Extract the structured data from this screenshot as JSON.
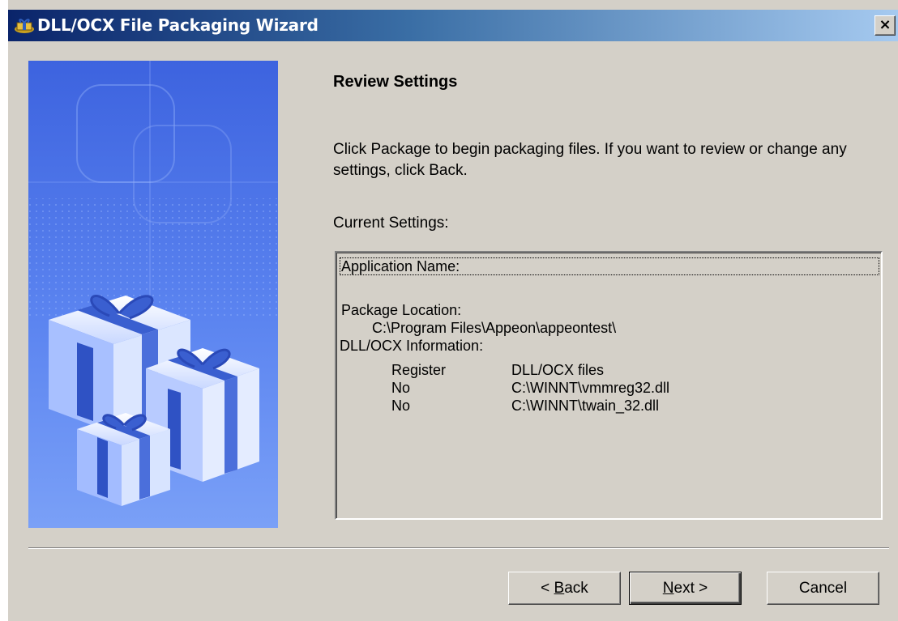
{
  "window": {
    "title": "DLL/OCX File Packaging Wizard",
    "close_label": "×"
  },
  "page": {
    "heading": "Review Settings",
    "intro": "Click Package to begin packaging files. If you want to review or change any settings, click Back.",
    "current_settings_label": "Current Settings:"
  },
  "settings": {
    "application_name_label": "Application Name:",
    "package_location_label": "Package Location:",
    "package_location_value": "C:\\Program Files\\Appeon\\appeontest\\",
    "dll_info_label": "DLL/OCX Information:",
    "columns": [
      "Register",
      "DLL/OCX files"
    ],
    "rows": [
      {
        "register": "No",
        "file": "C:\\WINNT\\vmmreg32.dll"
      },
      {
        "register": "No",
        "file": "C:\\WINNT\\twain_32.dll"
      }
    ]
  },
  "buttons": {
    "back": {
      "prefix": "< ",
      "mnemonic": "B",
      "rest": "ack"
    },
    "next": {
      "mnemonic": "N",
      "rest": "ext >"
    },
    "cancel": "Cancel"
  },
  "colors": {
    "title_start": "#0a246a",
    "title_end": "#a6caf0",
    "dialog_face": "#d4d0c8",
    "image_blue": "#5d86f0"
  },
  "icons": {
    "title_icon": "gift-package-icon",
    "close": "close-icon"
  }
}
